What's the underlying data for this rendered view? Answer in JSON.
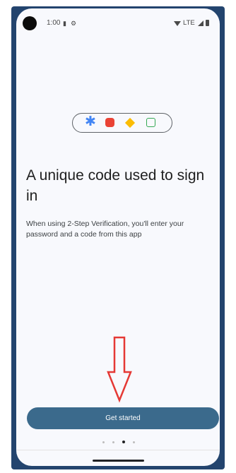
{
  "status_bar": {
    "time": "1:00",
    "network": "LTE",
    "icons": [
      "sd-card-icon",
      "vpn-icon",
      "wifi-icon",
      "signal-icon",
      "battery-icon"
    ]
  },
  "illustration": {
    "icons": [
      "asterisk-icon",
      "red-blob-icon",
      "yellow-diamond-icon",
      "green-square-icon"
    ],
    "colors": {
      "blue": "#4285f4",
      "red": "#ea4335",
      "yellow": "#fbbc04",
      "green": "#34a853"
    }
  },
  "content": {
    "title": "A unique code used to sign in",
    "description": "When using 2-Step Verification, you'll enter your password and a code from this app"
  },
  "annotation": {
    "icon": "arrow-down-icon",
    "color": "#e53935"
  },
  "actions": {
    "get_started_label": "Get started",
    "button_color": "#3b6a8c"
  },
  "pager": {
    "total": 4,
    "active_index": 2
  }
}
